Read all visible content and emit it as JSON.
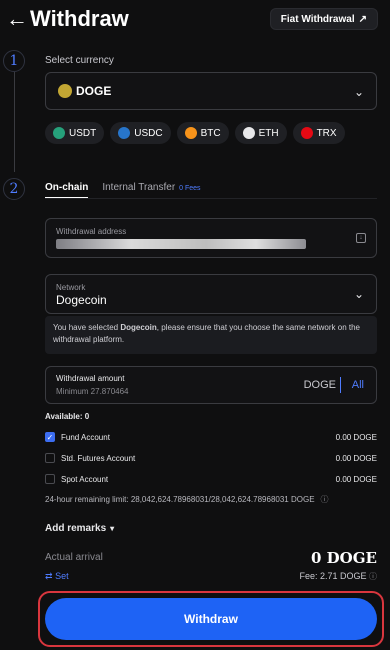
{
  "header": {
    "title": "Withdraw",
    "fiat_label": "Fiat Withdrawal"
  },
  "steps": [
    "1",
    "2"
  ],
  "currency": {
    "label": "Select currency",
    "selected": "DOGE",
    "chips": [
      {
        "label": "USDT",
        "color": "#26a17b"
      },
      {
        "label": "USDC",
        "color": "#2775ca"
      },
      {
        "label": "BTC",
        "color": "#f7931a"
      },
      {
        "label": "ETH",
        "color": "#e8e8ea"
      },
      {
        "label": "TRX",
        "color": "#e50914"
      }
    ]
  },
  "tabs": {
    "onchain": "On-chain",
    "internal": "Internal Transfer",
    "fees": "0 Fees"
  },
  "address": {
    "label": "Withdrawal address"
  },
  "network": {
    "label": "Network",
    "value": "Dogecoin",
    "note_pre": "You have selected ",
    "note_bold": "Dogecoin",
    "note_post": ", please ensure that you choose the same network on the withdrawal platform."
  },
  "amount": {
    "label": "Withdrawal amount",
    "minimum": "Minimum 27.870464",
    "unit": "DOGE",
    "all": "All"
  },
  "available": "Available:  0",
  "accounts": [
    {
      "name": "Fund Account",
      "value": "0.00 DOGE",
      "checked": true
    },
    {
      "name": "Std. Futures Account",
      "value": "0.00 DOGE",
      "checked": false
    },
    {
      "name": "Spot Account",
      "value": "0.00 DOGE",
      "checked": false
    }
  ],
  "limit": "24-hour remaining limit:  28,042,624.78968031/28,042,624.78968031 DOGE",
  "remarks": "Add remarks",
  "arrival": {
    "label": "Actual arrival",
    "value": "0 DOGE",
    "set": "Set",
    "fee": "Fee:  2.71 DOGE"
  },
  "submit": "Withdraw"
}
